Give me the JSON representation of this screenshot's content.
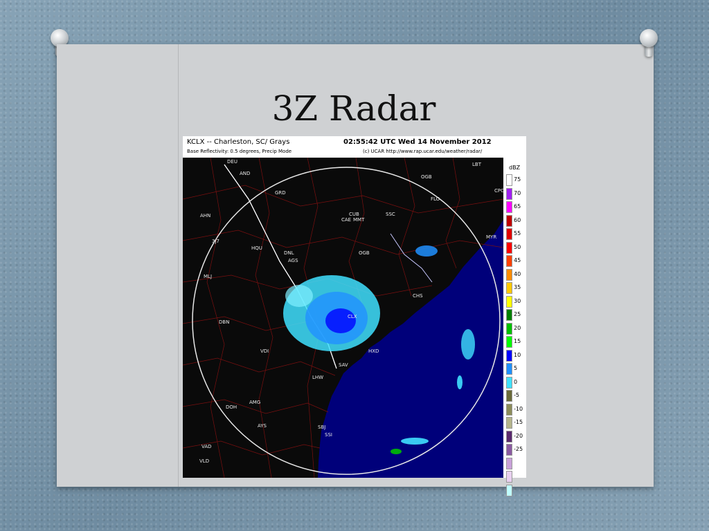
{
  "slide": {
    "title": "3Z Radar"
  },
  "radar": {
    "station": "KCLX -- Charleston, SC/ Grays",
    "product": "Base Reflectivity: 0.5 degrees, Precip Mode",
    "timestamp": "02:55:42 UTC Wed 14 November 2012",
    "credit": "(c) UCAR  http://www.rap.ucar.edu/weather/radar/",
    "scale_unit": "dBZ",
    "scale": [
      {
        "label": "75",
        "color": "#ffffff"
      },
      {
        "label": "70",
        "color": "#a020f0"
      },
      {
        "label": "65",
        "color": "#ff00ff"
      },
      {
        "label": "60",
        "color": "#c00000"
      },
      {
        "label": "55",
        "color": "#e00000"
      },
      {
        "label": "50",
        "color": "#ff0000"
      },
      {
        "label": "45",
        "color": "#ff4000"
      },
      {
        "label": "40",
        "color": "#ff8c00"
      },
      {
        "label": "35",
        "color": "#ffc800"
      },
      {
        "label": "30",
        "color": "#ffff00"
      },
      {
        "label": "25",
        "color": "#008000"
      },
      {
        "label": "20",
        "color": "#00c000"
      },
      {
        "label": "15",
        "color": "#00ff00"
      },
      {
        "label": "10",
        "color": "#0000ff"
      },
      {
        "label": "5",
        "color": "#2090ff"
      },
      {
        "label": "0",
        "color": "#40e0ff"
      },
      {
        "label": "-5",
        "color": "#6a6a3a"
      },
      {
        "label": "-10",
        "color": "#8c8c5a"
      },
      {
        "label": "-15",
        "color": "#b4b48c"
      },
      {
        "label": "-20",
        "color": "#5a2a6e"
      },
      {
        "label": "-25",
        "color": "#8a5aa0"
      },
      {
        "label": "",
        "color": "#c8a0d8"
      },
      {
        "label": "",
        "color": "#e8d0f0"
      },
      {
        "label": "",
        "color": "#c0ffff"
      }
    ],
    "map_labels": [
      {
        "id": "deu",
        "text": "DEU"
      },
      {
        "id": "and",
        "text": "AND"
      },
      {
        "id": "lbt",
        "text": "LBT"
      },
      {
        "id": "grd",
        "text": "GRD"
      },
      {
        "id": "ogb-n",
        "text": "OGB"
      },
      {
        "id": "flo",
        "text": "FLO"
      },
      {
        "id": "cpc",
        "text": "CPC"
      },
      {
        "id": "ahn",
        "text": "AHN"
      },
      {
        "id": "cub",
        "text": "CUB"
      },
      {
        "id": "cae",
        "text": "CAE"
      },
      {
        "id": "mmt",
        "text": "MMT"
      },
      {
        "id": "ssc",
        "text": "SSC"
      },
      {
        "id": "3j7",
        "text": "3J7"
      },
      {
        "id": "hqu",
        "text": "HQU"
      },
      {
        "id": "dnl",
        "text": "DNL"
      },
      {
        "id": "ags",
        "text": "AGS"
      },
      {
        "id": "ogb",
        "text": "OGB"
      },
      {
        "id": "mlj",
        "text": "MLJ"
      },
      {
        "id": "chs",
        "text": "CHS"
      },
      {
        "id": "clx",
        "text": "CLX"
      },
      {
        "id": "dbn",
        "text": "DBN"
      },
      {
        "id": "hxd",
        "text": "HXD"
      },
      {
        "id": "vdi",
        "text": "VDI"
      },
      {
        "id": "sav",
        "text": "SAV"
      },
      {
        "id": "lhw",
        "text": "LHW"
      },
      {
        "id": "amg",
        "text": "AMG"
      },
      {
        "id": "doh",
        "text": "DOH"
      },
      {
        "id": "ays",
        "text": "AYS"
      },
      {
        "id": "sbj",
        "text": "SBJ"
      },
      {
        "id": "ssi",
        "text": "SSI"
      },
      {
        "id": "vad",
        "text": "VAD"
      },
      {
        "id": "vld",
        "text": "VLD"
      },
      {
        "id": "myr",
        "text": "MYR"
      }
    ]
  }
}
